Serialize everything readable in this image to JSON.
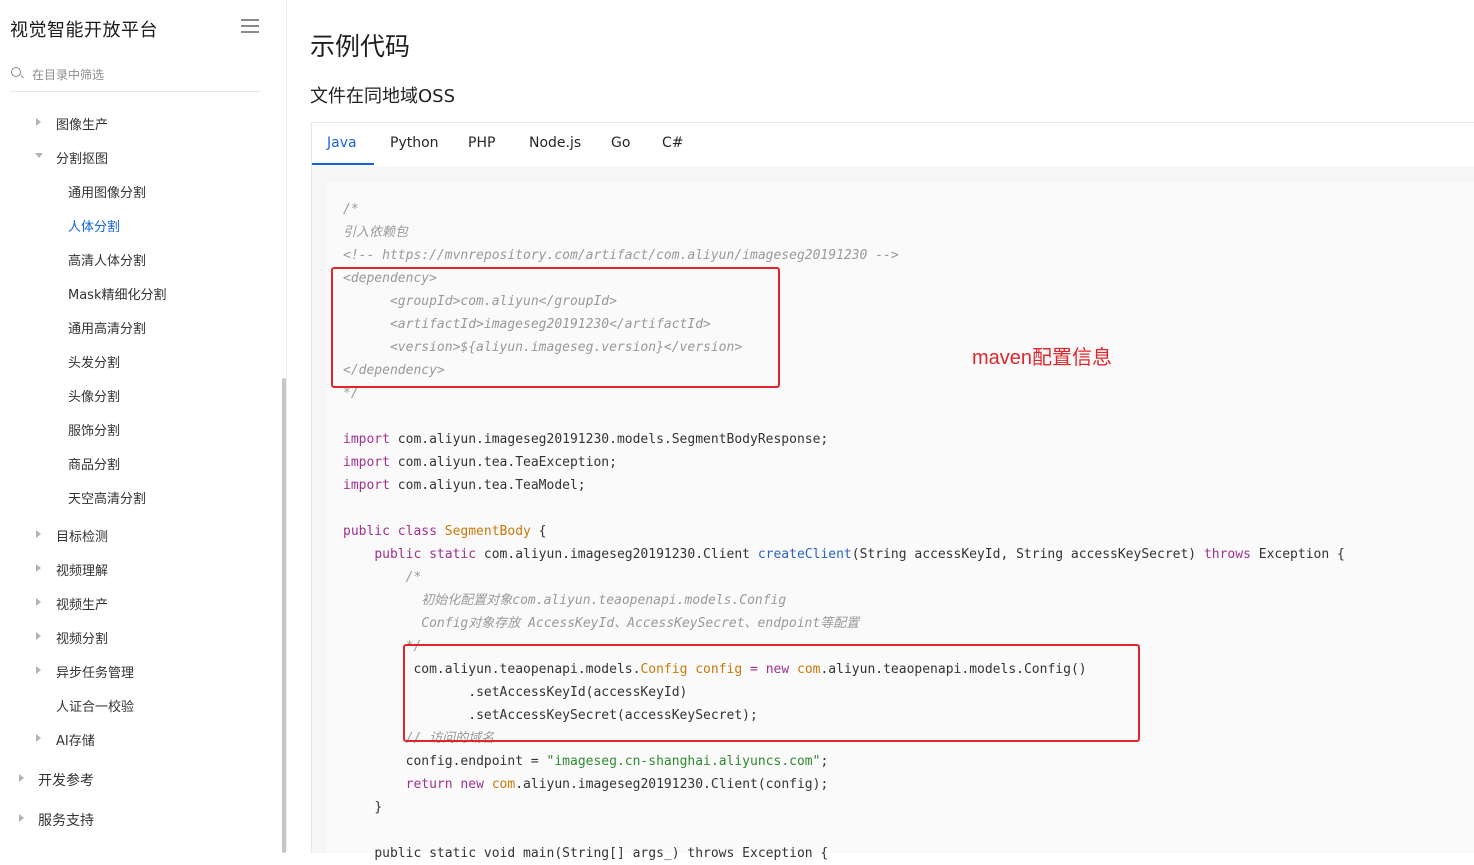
{
  "sidebar": {
    "title": "视觉智能开放平台",
    "search_placeholder": "在目录中筛选",
    "items": [
      {
        "label": "图像生产",
        "caret": "right"
      },
      {
        "label": "分割抠图",
        "caret": "down"
      },
      {
        "label": "通用图像分割"
      },
      {
        "label": "人体分割",
        "active": true
      },
      {
        "label": "高清人体分割"
      },
      {
        "label": "Mask精细化分割"
      },
      {
        "label": "通用高清分割"
      },
      {
        "label": "头发分割"
      },
      {
        "label": "头像分割"
      },
      {
        "label": "服饰分割"
      },
      {
        "label": "商品分割"
      },
      {
        "label": "天空高清分割"
      },
      {
        "label": "目标检测",
        "caret": "right"
      },
      {
        "label": "视频理解",
        "caret": "right"
      },
      {
        "label": "视频生产",
        "caret": "right"
      },
      {
        "label": "视频分割",
        "caret": "right"
      },
      {
        "label": "异步任务管理",
        "caret": "right"
      },
      {
        "label": "人证合一校验"
      },
      {
        "label": "AI存储",
        "caret": "right"
      },
      {
        "label": "开发参考",
        "caret": "right"
      },
      {
        "label": "服务支持",
        "caret": "right"
      }
    ]
  },
  "main": {
    "title": "示例代码",
    "section": "文件在同地域OSS",
    "tabs": [
      "Java",
      "Python",
      "PHP",
      "Node.js",
      "Go",
      "C#"
    ],
    "active_tab": "Java",
    "code": {
      "l1": "/*",
      "l2": "引入依赖包",
      "l3": "<!-- https://mvnrepository.com/artifact/com.aliyun/imageseg20191230 -->",
      "l4": "<dependency>",
      "l5": "      <groupId>com.aliyun</groupId>",
      "l6": "      <artifactId>imageseg20191230</artifactId>",
      "l7": "      <version>${aliyun.imageseg.version}</version>",
      "l8": "</dependency>",
      "l9": "*/",
      "imp1_kw": "import",
      "imp1": " com.aliyun.imageseg20191230.models.SegmentBodyResponse;",
      "imp2": " com.aliyun.tea.TeaException;",
      "imp3": " com.aliyun.tea.TeaModel;",
      "cls_kw": "public class",
      "cls_name": "SegmentBody",
      "cls_open": " {",
      "m1_kw": "public static",
      "m1_type": " com.aliyun.imageseg20191230.Client ",
      "m1_fn": "createClient",
      "m1_args": "(String accessKeyId, String accessKeySecret) ",
      "m1_throws": "throws",
      "m1_exc": " Exception {",
      "c1": "/*",
      "c2": "  初始化配置对象com.aliyun.teaopenapi.models.Config",
      "c3": "  Config对象存放 AccessKeyId、AccessKeySecret、endpoint等配置",
      "c4": "*/",
      "cfg_pre": "com.aliyun.teaopenapi.models.",
      "cfg_type": "Config",
      "cfg_var": " config",
      "cfg_eq": " = ",
      "cfg_new": "new",
      "cfg_new_pkg": " com",
      "cfg_rest": ".aliyun.teaopenapi.models.Config()",
      "set1": "       .setAccessKeyId(accessKeyId)",
      "set2": "       .setAccessKeySecret(accessKeySecret);",
      "cm_domain": "// 访问的域名",
      "ep_pre": "config.endpoint = ",
      "ep_str": "\"imageseg.cn-shanghai.aliyuncs.com\"",
      "ep_end": ";",
      "ret_kw": "return new",
      "ret_pkg": " com",
      "ret_rest": ".aliyun.imageseg20191230.Client(config);",
      "close1": "}",
      "last": "public static void main(String[] args_) throws Exception {"
    },
    "annotation": "maven配置信息"
  }
}
